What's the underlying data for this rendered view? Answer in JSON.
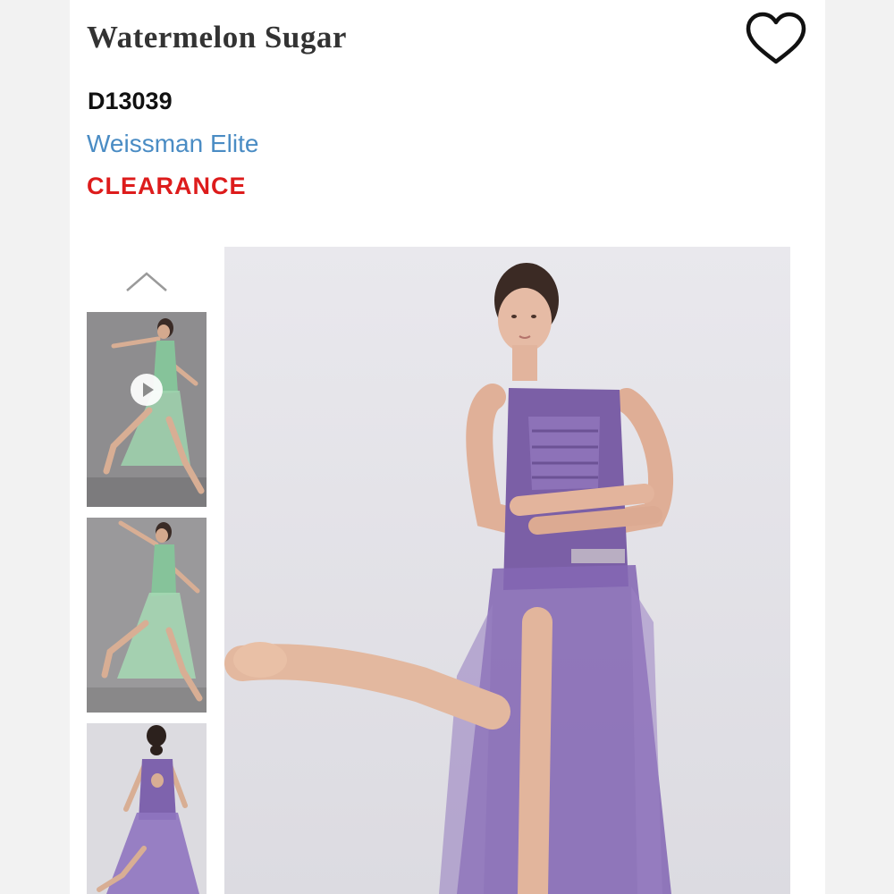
{
  "product": {
    "title": "Watermelon Sugar",
    "sku": "D13039",
    "brand": "Weissman Elite",
    "badge": "CLEARANCE"
  },
  "icons": {
    "wishlist": "heart-outline-icon",
    "gallery_up": "chevron-up-icon",
    "video": "play-circle-icon"
  },
  "colors": {
    "brand_link": "#4a8cc4",
    "clearance": "#dd1c1c",
    "title": "#333333"
  },
  "gallery": {
    "thumbnails": [
      {
        "variant": "green",
        "has_video": true,
        "selected": false
      },
      {
        "variant": "green",
        "has_video": false,
        "selected": false
      },
      {
        "variant": "purple",
        "has_video": false,
        "selected": false
      }
    ],
    "main_variant": "purple"
  }
}
